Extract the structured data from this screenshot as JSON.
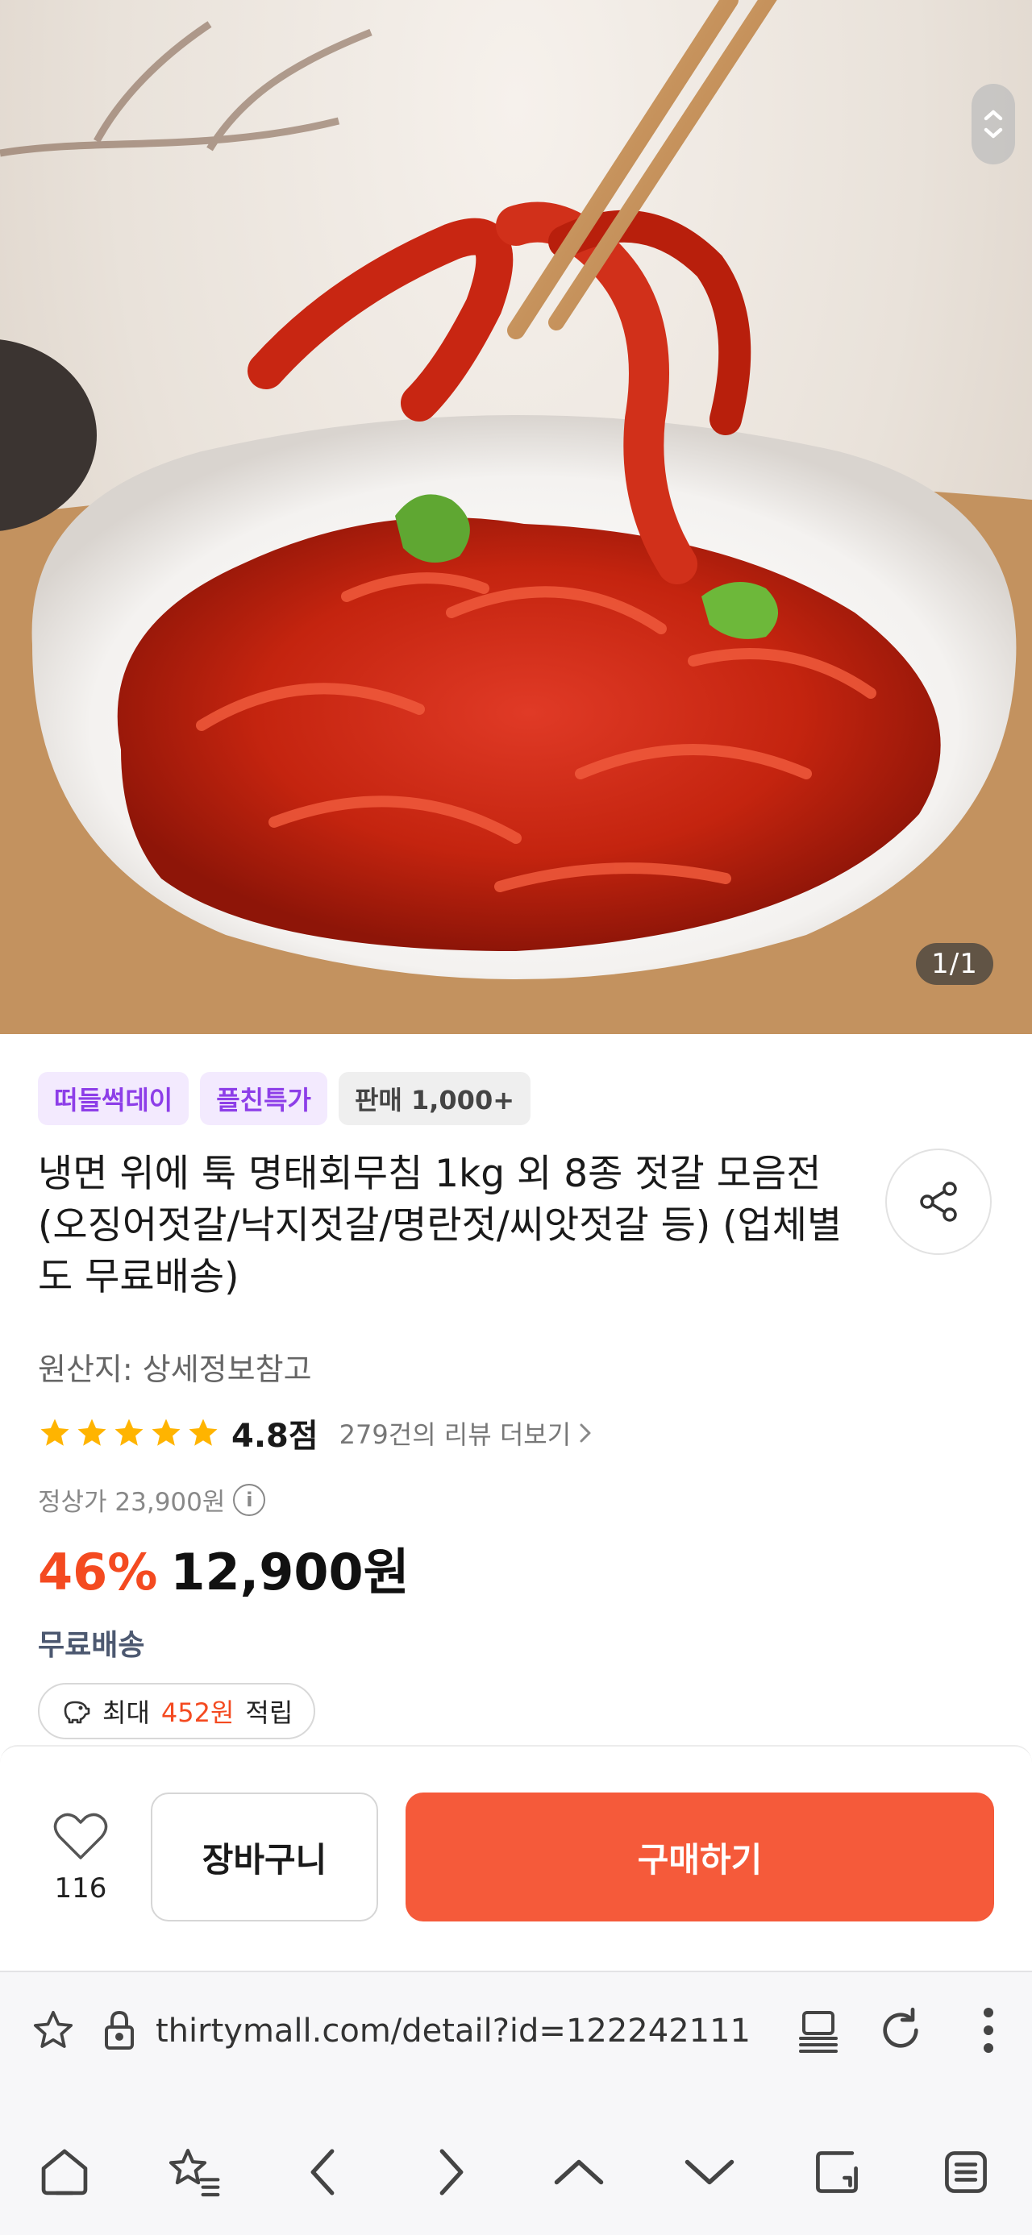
{
  "image": {
    "counter": "1/1"
  },
  "badges": [
    {
      "label": "떠들썩데이"
    },
    {
      "label": "플친특가"
    },
    {
      "label": "판매 1,000+"
    }
  ],
  "product": {
    "title": "냉면 위에 툭 명태회무침 1kg 외 8종 젓갈 모음전(오징어젓갈/낙지젓갈/명란젓/씨앗젓갈 등) (업체별도 무료배송)",
    "origin": "원산지: 상세정보참고",
    "rating": "4.8점",
    "rating_value": 4.8,
    "review_link": "279건의 리뷰 더보기",
    "list_price": "정상가 23,900원",
    "discount": "46%",
    "price": "12,900원",
    "shipping": "무료배송",
    "points": {
      "prefix": "최대",
      "amount": "452원",
      "suffix": "적립"
    }
  },
  "purchase_bar": {
    "like_count": "116",
    "cart_label": "장바구니",
    "buy_label": "구매하기"
  },
  "browser": {
    "url": "thirtymall.com/detail?id=122242111"
  },
  "colors": {
    "accent": "#f55a3a",
    "discount": "#f44a20",
    "badge_purple": "#8d3ee8",
    "shipping": "#4c5870"
  }
}
